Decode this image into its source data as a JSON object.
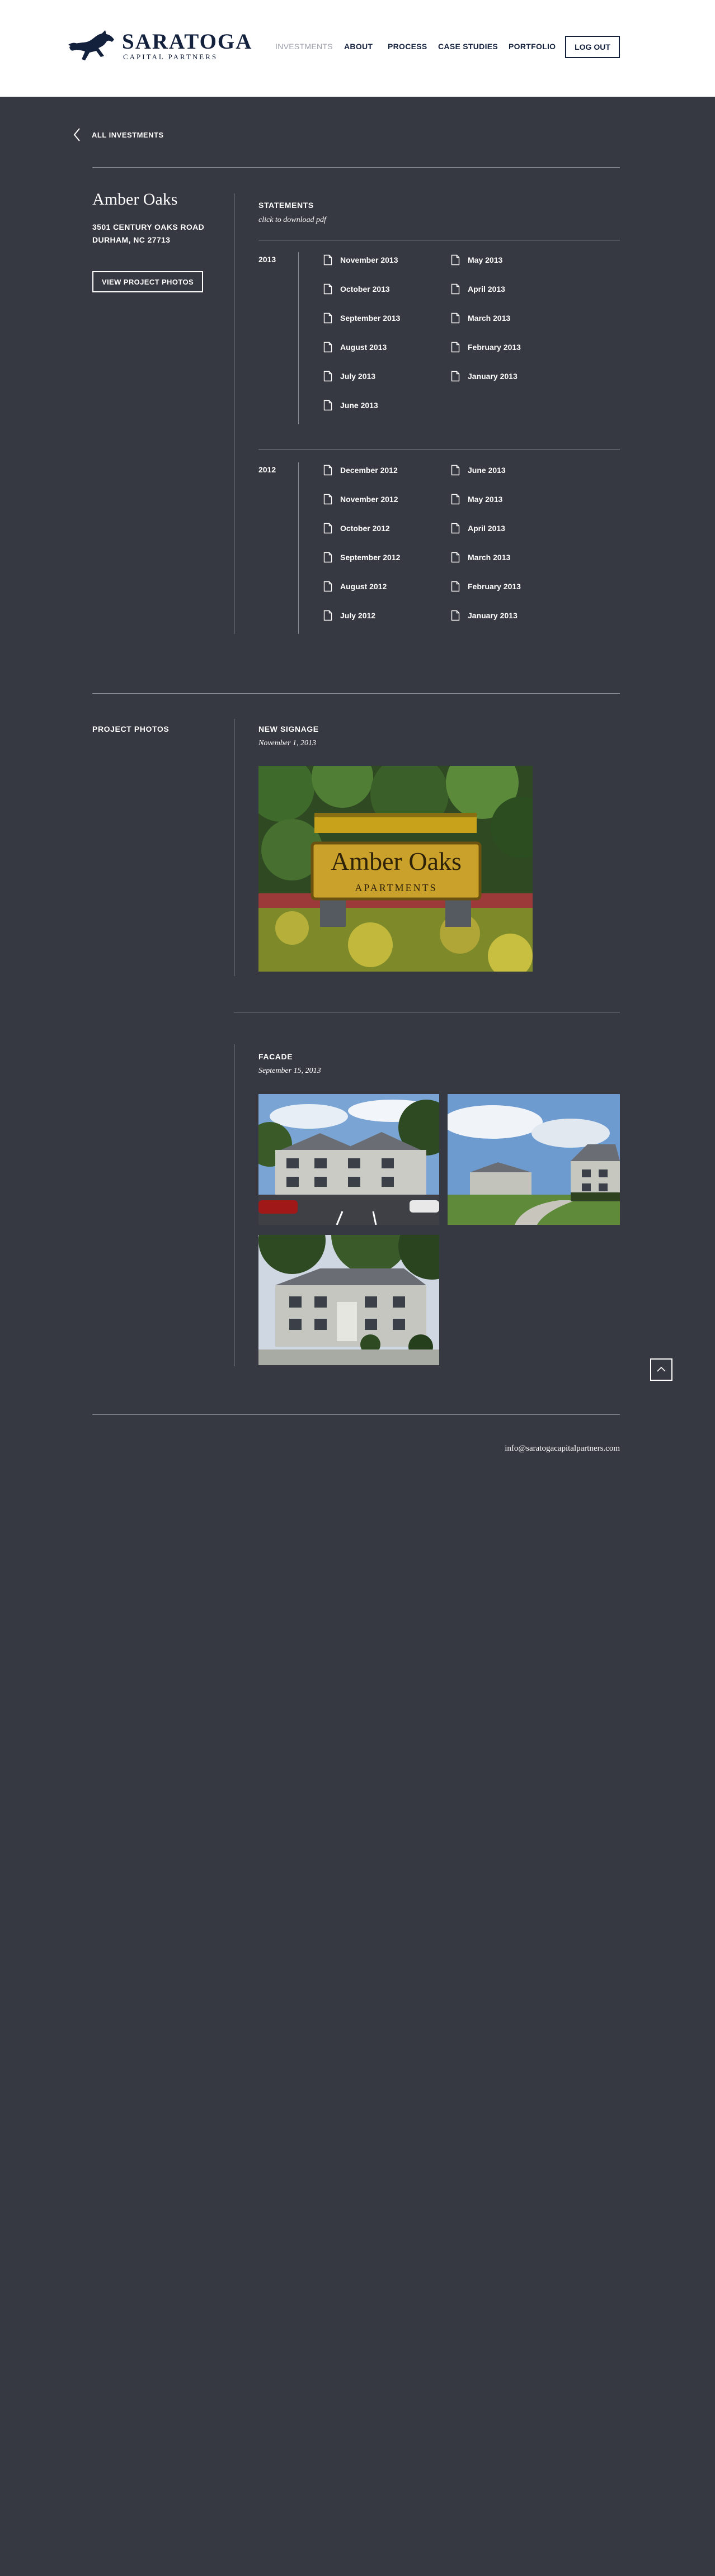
{
  "brand": {
    "name": "SARATOGA",
    "sub": "CAPITAL PARTNERS"
  },
  "nav": [
    {
      "label": "INVESTMENTS"
    },
    {
      "label": "ABOUT"
    },
    {
      "label": "PROCESS"
    },
    {
      "label": "CASE STUDIES"
    },
    {
      "label": "PORTFOLIO"
    }
  ],
  "logout_label": "LOG OUT",
  "back_label": "ALL INVESTMENTS",
  "property": {
    "name": "Amber Oaks",
    "address_line1": "3501 CENTURY OAKS ROAD",
    "address_line2": "DURHAM, NC 27713",
    "photos_button": "VIEW PROJECT PHOTOS"
  },
  "statements": {
    "heading": "STATEMENTS",
    "subheading": "click to download pdf",
    "years": [
      {
        "year": "2013",
        "left": [
          "November 2013",
          "October 2013",
          "September 2013",
          "August 2013",
          "July 2013",
          "June 2013"
        ],
        "right": [
          "May 2013",
          "April 2013",
          "March 2013",
          "February 2013",
          "January 2013"
        ]
      },
      {
        "year": "2012",
        "left": [
          "December 2012",
          "November 2012",
          "October 2012",
          "September 2012",
          "August 2012",
          "July 2012"
        ],
        "right": [
          "June 2013",
          "May 2013",
          "April 2013",
          "March 2013",
          "February 2013",
          "January 2013"
        ]
      }
    ]
  },
  "project_photos": {
    "heading": "PROJECT PHOTOS",
    "albums": [
      {
        "title": "NEW SIGNAGE",
        "date": "November 1, 2013",
        "sign_text": "Amber Oaks",
        "sign_sub": "APARTMENTS"
      },
      {
        "title": "FACADE",
        "date": "September 15, 2013"
      }
    ]
  },
  "footer": {
    "email": "info@saratogacapitalpartners.com"
  },
  "icons": {
    "back": "chevron-left-icon",
    "document": "document-icon",
    "top": "chevron-up-icon"
  },
  "colors": {
    "background": "#373942",
    "header": "#ffffff",
    "brand_navy": "#14213d",
    "rule": "#8a8c94"
  }
}
